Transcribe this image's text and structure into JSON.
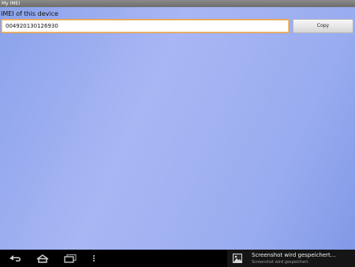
{
  "app": {
    "title": "My IMEI"
  },
  "main": {
    "label": "IMEI of this device",
    "imei_value": "004920130126930",
    "copy_label": "Copy"
  },
  "system_bar": {
    "notification": {
      "title": "Screenshot wird gespeichert...",
      "subtitle": "Screenshot wird gespeichert."
    },
    "icons": [
      "back-icon",
      "home-icon",
      "recent-apps-icon",
      "menu-dots-icon",
      "image-icon"
    ]
  },
  "colors": {
    "background_top": "#8aa2ea",
    "background_mid": "#a9b6f4",
    "input_border": "#e8a048",
    "navbar": "#000000"
  }
}
